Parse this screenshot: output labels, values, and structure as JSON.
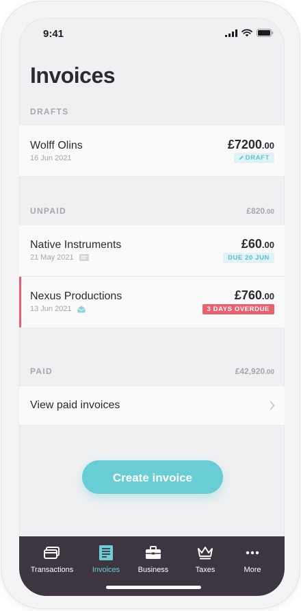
{
  "status_bar": {
    "time": "9:41"
  },
  "page_title": "Invoices",
  "drafts": {
    "label": "DRAFTS",
    "items": [
      {
        "name": "Wolff Olins",
        "date": "16 Jun 2021",
        "amount_main": "£7200",
        "amount_dec": ".00",
        "badge": "DRAFT"
      }
    ]
  },
  "unpaid": {
    "label": "UNPAID",
    "total_main": "£820",
    "total_dec": ".00",
    "items": [
      {
        "name": "Native Instruments",
        "date": "21 May 2021",
        "amount_main": "£60",
        "amount_dec": ".00",
        "badge": "DUE 20 JUN",
        "status_icon": "envelope-icon"
      },
      {
        "name": "Nexus Productions",
        "date": "13 Jun 2021",
        "amount_main": "£760",
        "amount_dec": ".00",
        "badge": "3 DAYS OVERDUE",
        "status_icon": "envelope-open-icon"
      }
    ]
  },
  "paid": {
    "label": "PAID",
    "total_main": "£42,920",
    "total_dec": ".00",
    "view_label": "View paid invoices"
  },
  "create_button_label": "Create invoice",
  "tabs": [
    {
      "label": "Transactions",
      "icon": "cards-icon",
      "active": false
    },
    {
      "label": "Invoices",
      "icon": "invoice-icon",
      "active": true
    },
    {
      "label": "Business",
      "icon": "briefcase-icon",
      "active": false
    },
    {
      "label": "Taxes",
      "icon": "crown-icon",
      "active": false
    },
    {
      "label": "More",
      "icon": "more-icon",
      "active": false
    }
  ],
  "colors": {
    "accent": "#68cdd5",
    "overdue": "#e9606e",
    "tab_bar": "#3d3540",
    "text": "#2b2a31"
  }
}
